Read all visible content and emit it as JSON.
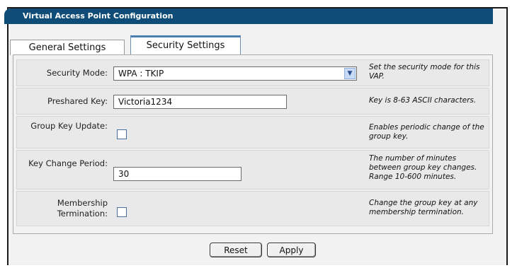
{
  "panel": {
    "title": "Virtual Access Point Configuration"
  },
  "tabs": [
    {
      "label": "General Settings",
      "active": false
    },
    {
      "label": "Security Settings",
      "active": true
    }
  ],
  "form": {
    "security_mode": {
      "label": "Security Mode:",
      "value": "WPA : TKIP",
      "help": "Set the security mode for this VAP."
    },
    "preshared_key": {
      "label": "Preshared Key:",
      "value": "Victoria1234",
      "help": "Key is 8-63 ASCII characters."
    },
    "group_key_update": {
      "label": "Group Key Update:",
      "checked": false,
      "help": "Enables periodic change of the group key."
    },
    "key_change_period": {
      "label": "Key Change Period:",
      "value": "30",
      "help": "The number of minutes between group key changes. Range 10-600 minutes."
    },
    "membership_termination": {
      "label": "Membership Termination:",
      "checked": false,
      "help": "Change the group key at any membership termination."
    }
  },
  "buttons": {
    "reset": "Reset",
    "apply": "Apply"
  },
  "colors": {
    "title_bar": "#0f4d78",
    "tab_accent": "#4a7fb0"
  }
}
